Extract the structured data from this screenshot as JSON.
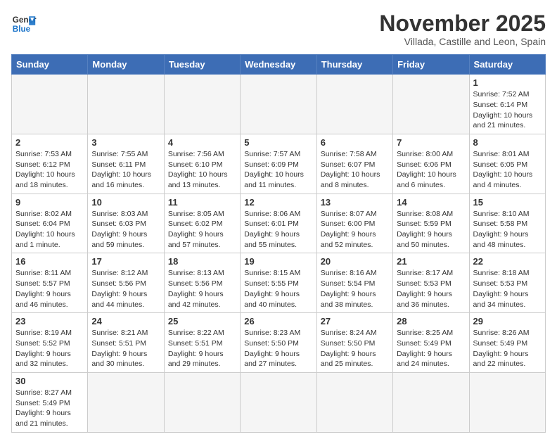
{
  "logo": {
    "line1": "General",
    "line2": "Blue"
  },
  "title": "November 2025",
  "subtitle": "Villada, Castille and Leon, Spain",
  "headers": [
    "Sunday",
    "Monday",
    "Tuesday",
    "Wednesday",
    "Thursday",
    "Friday",
    "Saturday"
  ],
  "weeks": [
    [
      {
        "day": "",
        "info": ""
      },
      {
        "day": "",
        "info": ""
      },
      {
        "day": "",
        "info": ""
      },
      {
        "day": "",
        "info": ""
      },
      {
        "day": "",
        "info": ""
      },
      {
        "day": "",
        "info": ""
      },
      {
        "day": "1",
        "info": "Sunrise: 7:52 AM\nSunset: 6:14 PM\nDaylight: 10 hours and 21 minutes."
      }
    ],
    [
      {
        "day": "2",
        "info": "Sunrise: 7:53 AM\nSunset: 6:12 PM\nDaylight: 10 hours and 18 minutes."
      },
      {
        "day": "3",
        "info": "Sunrise: 7:55 AM\nSunset: 6:11 PM\nDaylight: 10 hours and 16 minutes."
      },
      {
        "day": "4",
        "info": "Sunrise: 7:56 AM\nSunset: 6:10 PM\nDaylight: 10 hours and 13 minutes."
      },
      {
        "day": "5",
        "info": "Sunrise: 7:57 AM\nSunset: 6:09 PM\nDaylight: 10 hours and 11 minutes."
      },
      {
        "day": "6",
        "info": "Sunrise: 7:58 AM\nSunset: 6:07 PM\nDaylight: 10 hours and 8 minutes."
      },
      {
        "day": "7",
        "info": "Sunrise: 8:00 AM\nSunset: 6:06 PM\nDaylight: 10 hours and 6 minutes."
      },
      {
        "day": "8",
        "info": "Sunrise: 8:01 AM\nSunset: 6:05 PM\nDaylight: 10 hours and 4 minutes."
      }
    ],
    [
      {
        "day": "9",
        "info": "Sunrise: 8:02 AM\nSunset: 6:04 PM\nDaylight: 10 hours and 1 minute."
      },
      {
        "day": "10",
        "info": "Sunrise: 8:03 AM\nSunset: 6:03 PM\nDaylight: 9 hours and 59 minutes."
      },
      {
        "day": "11",
        "info": "Sunrise: 8:05 AM\nSunset: 6:02 PM\nDaylight: 9 hours and 57 minutes."
      },
      {
        "day": "12",
        "info": "Sunrise: 8:06 AM\nSunset: 6:01 PM\nDaylight: 9 hours and 55 minutes."
      },
      {
        "day": "13",
        "info": "Sunrise: 8:07 AM\nSunset: 6:00 PM\nDaylight: 9 hours and 52 minutes."
      },
      {
        "day": "14",
        "info": "Sunrise: 8:08 AM\nSunset: 5:59 PM\nDaylight: 9 hours and 50 minutes."
      },
      {
        "day": "15",
        "info": "Sunrise: 8:10 AM\nSunset: 5:58 PM\nDaylight: 9 hours and 48 minutes."
      }
    ],
    [
      {
        "day": "16",
        "info": "Sunrise: 8:11 AM\nSunset: 5:57 PM\nDaylight: 9 hours and 46 minutes."
      },
      {
        "day": "17",
        "info": "Sunrise: 8:12 AM\nSunset: 5:56 PM\nDaylight: 9 hours and 44 minutes."
      },
      {
        "day": "18",
        "info": "Sunrise: 8:13 AM\nSunset: 5:56 PM\nDaylight: 9 hours and 42 minutes."
      },
      {
        "day": "19",
        "info": "Sunrise: 8:15 AM\nSunset: 5:55 PM\nDaylight: 9 hours and 40 minutes."
      },
      {
        "day": "20",
        "info": "Sunrise: 8:16 AM\nSunset: 5:54 PM\nDaylight: 9 hours and 38 minutes."
      },
      {
        "day": "21",
        "info": "Sunrise: 8:17 AM\nSunset: 5:53 PM\nDaylight: 9 hours and 36 minutes."
      },
      {
        "day": "22",
        "info": "Sunrise: 8:18 AM\nSunset: 5:53 PM\nDaylight: 9 hours and 34 minutes."
      }
    ],
    [
      {
        "day": "23",
        "info": "Sunrise: 8:19 AM\nSunset: 5:52 PM\nDaylight: 9 hours and 32 minutes."
      },
      {
        "day": "24",
        "info": "Sunrise: 8:21 AM\nSunset: 5:51 PM\nDaylight: 9 hours and 30 minutes."
      },
      {
        "day": "25",
        "info": "Sunrise: 8:22 AM\nSunset: 5:51 PM\nDaylight: 9 hours and 29 minutes."
      },
      {
        "day": "26",
        "info": "Sunrise: 8:23 AM\nSunset: 5:50 PM\nDaylight: 9 hours and 27 minutes."
      },
      {
        "day": "27",
        "info": "Sunrise: 8:24 AM\nSunset: 5:50 PM\nDaylight: 9 hours and 25 minutes."
      },
      {
        "day": "28",
        "info": "Sunrise: 8:25 AM\nSunset: 5:49 PM\nDaylight: 9 hours and 24 minutes."
      },
      {
        "day": "29",
        "info": "Sunrise: 8:26 AM\nSunset: 5:49 PM\nDaylight: 9 hours and 22 minutes."
      }
    ],
    [
      {
        "day": "30",
        "info": "Sunrise: 8:27 AM\nSunset: 5:49 PM\nDaylight: 9 hours and 21 minutes."
      },
      {
        "day": "",
        "info": ""
      },
      {
        "day": "",
        "info": ""
      },
      {
        "day": "",
        "info": ""
      },
      {
        "day": "",
        "info": ""
      },
      {
        "day": "",
        "info": ""
      },
      {
        "day": "",
        "info": ""
      }
    ]
  ]
}
